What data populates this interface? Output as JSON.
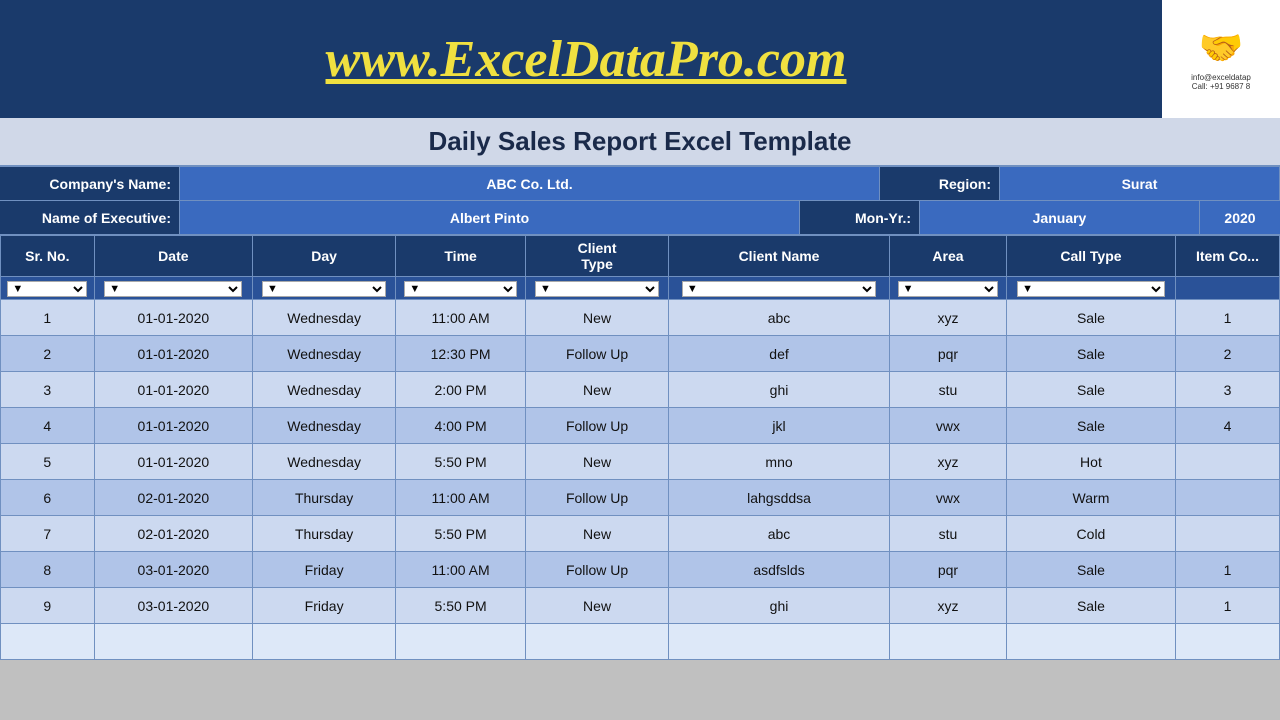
{
  "header": {
    "website": "www.ExcelDataPro.com",
    "logo_line1": "info@exceldatap",
    "logo_line2": "Call: +91 9687 8",
    "logo_emoji": "🤝"
  },
  "subtitle": "Daily Sales Report Excel Template",
  "info": {
    "company_label": "Company's Name:",
    "company_value": "ABC Co. Ltd.",
    "region_label": "Region:",
    "region_value": "Surat",
    "executive_label": "Name of Executive:",
    "executive_value": "Albert Pinto",
    "monyr_label": "Mon-Yr.:",
    "month_value": "January",
    "year_value": "2020"
  },
  "table": {
    "headers": [
      "Sr. No.",
      "Date",
      "Day",
      "Time",
      "Client\nType",
      "Client Name",
      "Area",
      "Call Type",
      "Item Co..."
    ],
    "filter_placeholders": [
      "▼",
      "▼",
      "▼",
      "▼",
      "▼",
      "▼",
      "▼",
      "▼"
    ],
    "rows": [
      {
        "sr": "1",
        "date": "01-01-2020",
        "day": "Wednesday",
        "time": "11:00 AM",
        "client_type": "New",
        "client_name": "abc",
        "area": "xyz",
        "call_type": "Sale",
        "item_code": "1"
      },
      {
        "sr": "2",
        "date": "01-01-2020",
        "day": "Wednesday",
        "time": "12:30 PM",
        "client_type": "Follow Up",
        "client_name": "def",
        "area": "pqr",
        "call_type": "Sale",
        "item_code": "2"
      },
      {
        "sr": "3",
        "date": "01-01-2020",
        "day": "Wednesday",
        "time": "2:00 PM",
        "client_type": "New",
        "client_name": "ghi",
        "area": "stu",
        "call_type": "Sale",
        "item_code": "3"
      },
      {
        "sr": "4",
        "date": "01-01-2020",
        "day": "Wednesday",
        "time": "4:00 PM",
        "client_type": "Follow Up",
        "client_name": "jkl",
        "area": "vwx",
        "call_type": "Sale",
        "item_code": "4"
      },
      {
        "sr": "5",
        "date": "01-01-2020",
        "day": "Wednesday",
        "time": "5:50 PM",
        "client_type": "New",
        "client_name": "mno",
        "area": "xyz",
        "call_type": "Hot",
        "item_code": ""
      },
      {
        "sr": "6",
        "date": "02-01-2020",
        "day": "Thursday",
        "time": "11:00 AM",
        "client_type": "Follow Up",
        "client_name": "lahgsddsa",
        "area": "vwx",
        "call_type": "Warm",
        "item_code": ""
      },
      {
        "sr": "7",
        "date": "02-01-2020",
        "day": "Thursday",
        "time": "5:50 PM",
        "client_type": "New",
        "client_name": "abc",
        "area": "stu",
        "call_type": "Cold",
        "item_code": ""
      },
      {
        "sr": "8",
        "date": "03-01-2020",
        "day": "Friday",
        "time": "11:00 AM",
        "client_type": "Follow Up",
        "client_name": "asdfslds",
        "area": "pqr",
        "call_type": "Sale",
        "item_code": "1"
      },
      {
        "sr": "9",
        "date": "03-01-2020",
        "day": "Friday",
        "time": "5:50 PM",
        "client_type": "New",
        "client_name": "ghi",
        "area": "xyz",
        "call_type": "Sale",
        "item_code": "1"
      }
    ]
  }
}
